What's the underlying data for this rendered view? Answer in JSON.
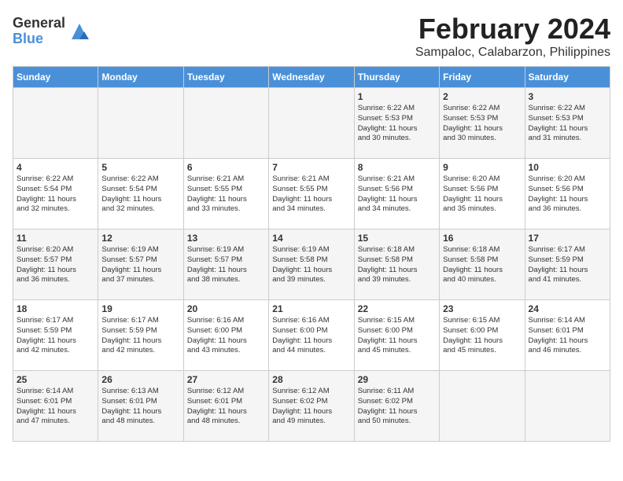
{
  "header": {
    "logo_general": "General",
    "logo_blue": "Blue",
    "month_title": "February 2024",
    "location": "Sampaloc, Calabarzon, Philippines"
  },
  "days_of_week": [
    "Sunday",
    "Monday",
    "Tuesday",
    "Wednesday",
    "Thursday",
    "Friday",
    "Saturday"
  ],
  "weeks": [
    [
      {
        "day": "",
        "content": ""
      },
      {
        "day": "",
        "content": ""
      },
      {
        "day": "",
        "content": ""
      },
      {
        "day": "",
        "content": ""
      },
      {
        "day": "1",
        "content": "Sunrise: 6:22 AM\nSunset: 5:53 PM\nDaylight: 11 hours\nand 30 minutes."
      },
      {
        "day": "2",
        "content": "Sunrise: 6:22 AM\nSunset: 5:53 PM\nDaylight: 11 hours\nand 30 minutes."
      },
      {
        "day": "3",
        "content": "Sunrise: 6:22 AM\nSunset: 5:53 PM\nDaylight: 11 hours\nand 31 minutes."
      }
    ],
    [
      {
        "day": "4",
        "content": "Sunrise: 6:22 AM\nSunset: 5:54 PM\nDaylight: 11 hours\nand 32 minutes."
      },
      {
        "day": "5",
        "content": "Sunrise: 6:22 AM\nSunset: 5:54 PM\nDaylight: 11 hours\nand 32 minutes."
      },
      {
        "day": "6",
        "content": "Sunrise: 6:21 AM\nSunset: 5:55 PM\nDaylight: 11 hours\nand 33 minutes."
      },
      {
        "day": "7",
        "content": "Sunrise: 6:21 AM\nSunset: 5:55 PM\nDaylight: 11 hours\nand 34 minutes."
      },
      {
        "day": "8",
        "content": "Sunrise: 6:21 AM\nSunset: 5:56 PM\nDaylight: 11 hours\nand 34 minutes."
      },
      {
        "day": "9",
        "content": "Sunrise: 6:20 AM\nSunset: 5:56 PM\nDaylight: 11 hours\nand 35 minutes."
      },
      {
        "day": "10",
        "content": "Sunrise: 6:20 AM\nSunset: 5:56 PM\nDaylight: 11 hours\nand 36 minutes."
      }
    ],
    [
      {
        "day": "11",
        "content": "Sunrise: 6:20 AM\nSunset: 5:57 PM\nDaylight: 11 hours\nand 36 minutes."
      },
      {
        "day": "12",
        "content": "Sunrise: 6:19 AM\nSunset: 5:57 PM\nDaylight: 11 hours\nand 37 minutes."
      },
      {
        "day": "13",
        "content": "Sunrise: 6:19 AM\nSunset: 5:57 PM\nDaylight: 11 hours\nand 38 minutes."
      },
      {
        "day": "14",
        "content": "Sunrise: 6:19 AM\nSunset: 5:58 PM\nDaylight: 11 hours\nand 39 minutes."
      },
      {
        "day": "15",
        "content": "Sunrise: 6:18 AM\nSunset: 5:58 PM\nDaylight: 11 hours\nand 39 minutes."
      },
      {
        "day": "16",
        "content": "Sunrise: 6:18 AM\nSunset: 5:58 PM\nDaylight: 11 hours\nand 40 minutes."
      },
      {
        "day": "17",
        "content": "Sunrise: 6:17 AM\nSunset: 5:59 PM\nDaylight: 11 hours\nand 41 minutes."
      }
    ],
    [
      {
        "day": "18",
        "content": "Sunrise: 6:17 AM\nSunset: 5:59 PM\nDaylight: 11 hours\nand 42 minutes."
      },
      {
        "day": "19",
        "content": "Sunrise: 6:17 AM\nSunset: 5:59 PM\nDaylight: 11 hours\nand 42 minutes."
      },
      {
        "day": "20",
        "content": "Sunrise: 6:16 AM\nSunset: 6:00 PM\nDaylight: 11 hours\nand 43 minutes."
      },
      {
        "day": "21",
        "content": "Sunrise: 6:16 AM\nSunset: 6:00 PM\nDaylight: 11 hours\nand 44 minutes."
      },
      {
        "day": "22",
        "content": "Sunrise: 6:15 AM\nSunset: 6:00 PM\nDaylight: 11 hours\nand 45 minutes."
      },
      {
        "day": "23",
        "content": "Sunrise: 6:15 AM\nSunset: 6:00 PM\nDaylight: 11 hours\nand 45 minutes."
      },
      {
        "day": "24",
        "content": "Sunrise: 6:14 AM\nSunset: 6:01 PM\nDaylight: 11 hours\nand 46 minutes."
      }
    ],
    [
      {
        "day": "25",
        "content": "Sunrise: 6:14 AM\nSunset: 6:01 PM\nDaylight: 11 hours\nand 47 minutes."
      },
      {
        "day": "26",
        "content": "Sunrise: 6:13 AM\nSunset: 6:01 PM\nDaylight: 11 hours\nand 48 minutes."
      },
      {
        "day": "27",
        "content": "Sunrise: 6:12 AM\nSunset: 6:01 PM\nDaylight: 11 hours\nand 48 minutes."
      },
      {
        "day": "28",
        "content": "Sunrise: 6:12 AM\nSunset: 6:02 PM\nDaylight: 11 hours\nand 49 minutes."
      },
      {
        "day": "29",
        "content": "Sunrise: 6:11 AM\nSunset: 6:02 PM\nDaylight: 11 hours\nand 50 minutes."
      },
      {
        "day": "",
        "content": ""
      },
      {
        "day": "",
        "content": ""
      }
    ]
  ]
}
